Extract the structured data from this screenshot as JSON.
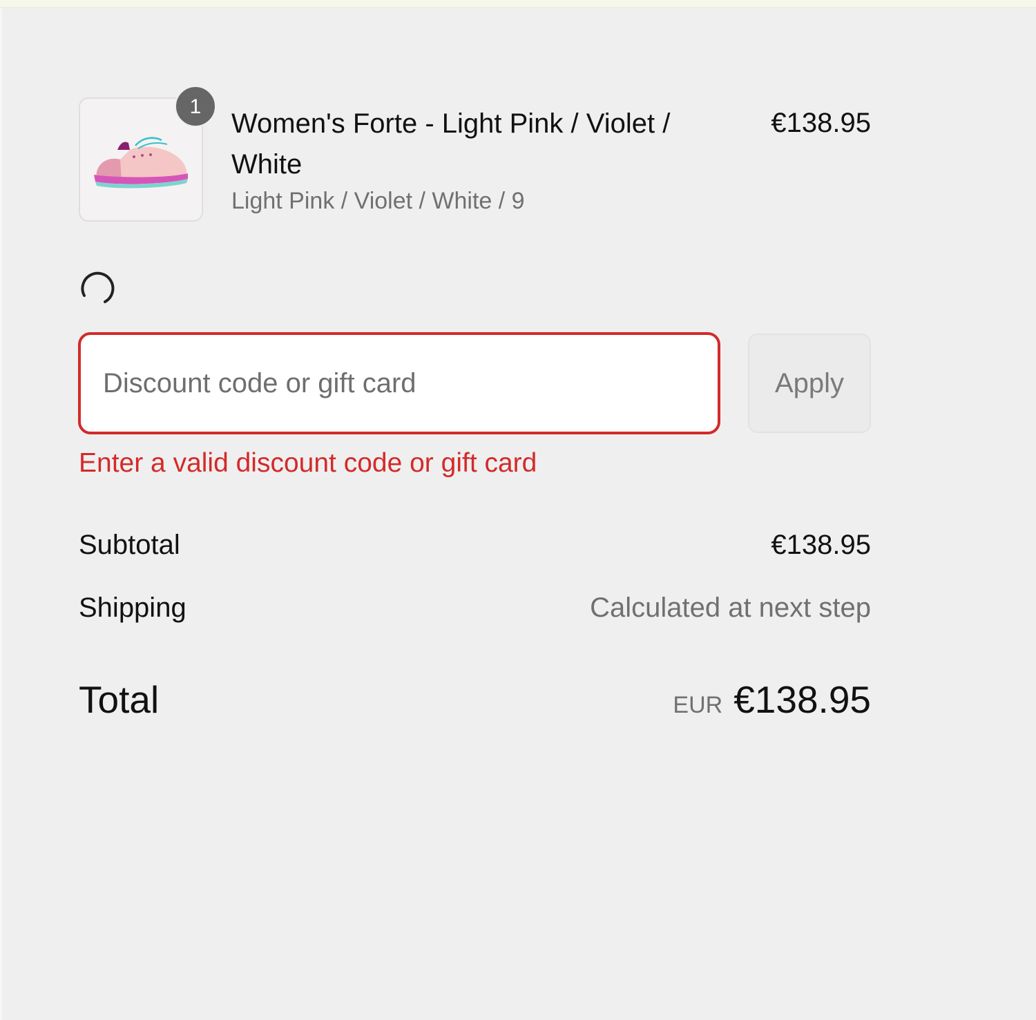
{
  "cart": {
    "item": {
      "title": "Women's Forte - Light Pink / Violet / White",
      "variant": "Light Pink / Violet / White / 9",
      "price": "€138.95",
      "quantity": "1",
      "image_icon": "sneaker-image"
    }
  },
  "discount": {
    "placeholder": "Discount code or gift card",
    "value": "",
    "apply_label": "Apply",
    "error": "Enter a valid discount code or gift card",
    "error_color": "#d32a2a"
  },
  "summary": {
    "subtotal_label": "Subtotal",
    "subtotal_value": "€138.95",
    "shipping_label": "Shipping",
    "shipping_value": "Calculated at next step",
    "total_label": "Total",
    "total_currency": "EUR",
    "total_value": "€138.95"
  }
}
